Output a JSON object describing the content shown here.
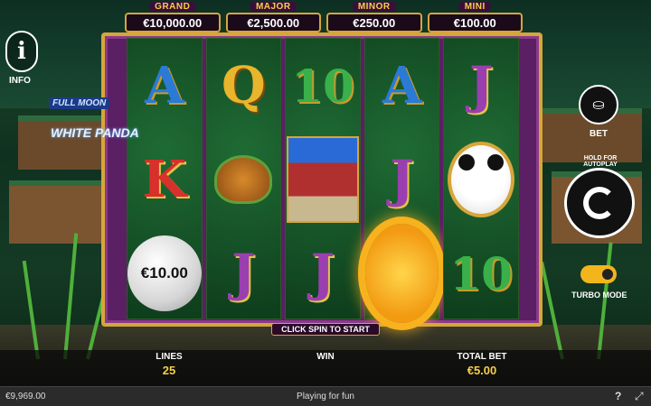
{
  "jackpots": [
    {
      "name": "GRAND",
      "amount": "€10,000.00"
    },
    {
      "name": "MAJOR",
      "amount": "€2,500.00"
    },
    {
      "name": "MINOR",
      "amount": "€250.00"
    },
    {
      "name": "MINI",
      "amount": "€100.00"
    }
  ],
  "info": {
    "label": "INFO",
    "glyph": "i"
  },
  "logo": {
    "line1": "FULL MOON",
    "line2": "WHITE PANDA"
  },
  "reels": [
    [
      "A",
      "K",
      "€10.00"
    ],
    [
      "Q",
      "turtle",
      "J"
    ],
    [
      "10",
      "temple",
      "J"
    ],
    [
      "A",
      "J",
      "sun"
    ],
    [
      "J",
      "panda",
      "10"
    ]
  ],
  "controls": {
    "bet_label": "BET",
    "bet_icon": "coins-plus-minus-icon",
    "autoplay_label": "HOLD FOR AUTOPLAY",
    "turbo_label": "TURBO MODE",
    "turbo_on": true,
    "click_spin": "CLICK SPIN TO START"
  },
  "stats": {
    "lines_label": "LINES",
    "lines_value": "25",
    "win_label": "WIN",
    "win_value": "",
    "total_label": "TOTAL BET",
    "total_value": "€5.00"
  },
  "footer": {
    "balance": "€9,969.00",
    "mode": "Playing for fun",
    "help": "?",
    "fullscreen": "⤢"
  },
  "colors": {
    "gold": "#d6a63a",
    "purple_frame": "#5b1f63",
    "turbo": "#f2b51c"
  }
}
